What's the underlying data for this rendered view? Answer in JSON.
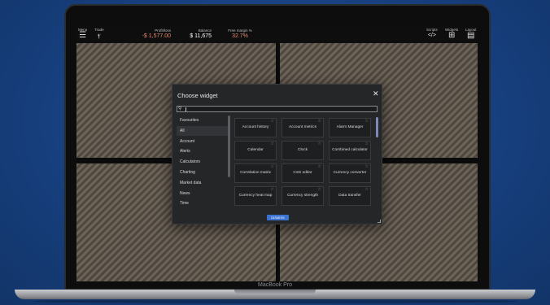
{
  "device": {
    "label": "MacBook Pro"
  },
  "header": {
    "menu": {
      "label": "Menu",
      "icon": "hamburger-icon"
    },
    "trade": {
      "label": "Trade",
      "icon": "trade-logo-icon"
    },
    "stats": [
      {
        "label": "Profit/loss",
        "value": "-$ 1,577.00",
        "color": "#e8896a"
      },
      {
        "label": "Balance",
        "value": "$ 11,675",
        "color": "#ffffff"
      },
      {
        "label": "Free margin %",
        "value": "32.7%",
        "color": "#e8896a"
      }
    ],
    "scripts": {
      "label": "Scripts",
      "icon": "code-icon"
    },
    "widgets": {
      "label": "Widgets",
      "icon": "grid-icon"
    },
    "layout": {
      "label": "Layout",
      "icon": "layout-icon"
    }
  },
  "modal": {
    "title": "Choose widget",
    "close_icon": "close-icon",
    "search": {
      "icon": "search-icon",
      "value": ""
    },
    "categories": [
      "Favourites",
      "All",
      "Account",
      "Alerts",
      "Calculators",
      "Charting",
      "Market data",
      "News",
      "Time"
    ],
    "selected_category": "All",
    "widgets": [
      "Account history",
      "Account metrics",
      "Alarm Manager",
      "Calendar",
      "Clock",
      "Combined calculator",
      "Correlation matrix",
      "CSS editor",
      "Currency converter",
      "Currency heat map",
      "Currency strength",
      "Data transfer"
    ],
    "star_icon": "star-icon",
    "dismiss_label": "DISMISS"
  }
}
